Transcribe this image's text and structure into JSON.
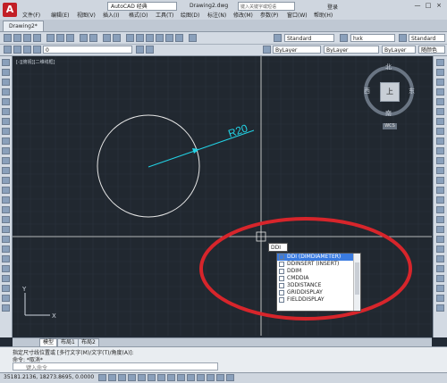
{
  "titlebar": {
    "workspace": "AutoCAD 经典",
    "doc_title": "Drawing2.dwg",
    "search_placeholder": "键入关键字或短语",
    "login": "登录",
    "menus": [
      "文件(F)",
      "编辑(E)",
      "视图(V)",
      "插入(I)",
      "格式(O)",
      "工具(T)",
      "绘图(D)",
      "标注(N)",
      "修改(M)",
      "参数(P)",
      "窗口(W)",
      "帮助(H)"
    ],
    "window_buttons": [
      "—",
      "□",
      "×"
    ]
  },
  "tabs": {
    "doc_tab": "Drawing2*"
  },
  "toolbar": {
    "text_style": "Standard",
    "dim_style": "hxk",
    "table_style": "Standard",
    "layer": "0",
    "color": "ByLayer",
    "linetype": "ByLayer",
    "lineweight": "ByLayer",
    "plot_style": "随颜色"
  },
  "viewport": {
    "label": "[-][俯视][二维线框]"
  },
  "drawing": {
    "dimension_text": "R20",
    "colors": {
      "circle": "#e6e6e6",
      "dimension": "#22d3e6",
      "annotation": "#d7252b",
      "canvas": "#212830"
    }
  },
  "viewcube": {
    "north": "北",
    "south": "南",
    "east": "东",
    "west": "西",
    "face": "上",
    "wcs": "WCS"
  },
  "autocomplete": {
    "input": "DDI",
    "items": [
      "DDI (DIMDIAMETER)",
      "DDINSERT (INSERT)",
      "DDIM",
      "CMDDIA",
      "3DDISTANCE",
      "GRIDDISPLAY",
      "FIELDDISPLAY"
    ],
    "selected_index": 0
  },
  "layout_tabs": [
    "模型",
    "布局1",
    "布局2"
  ],
  "command_lines": [
    "指定尺寸线位置或 [多行文字(M)/文字(T)/角度(A)]:",
    "命令: *取消*"
  ],
  "command_prompt": "键入命令",
  "status": {
    "coords": "35181.2136, 18273.8695, 0.0000"
  }
}
